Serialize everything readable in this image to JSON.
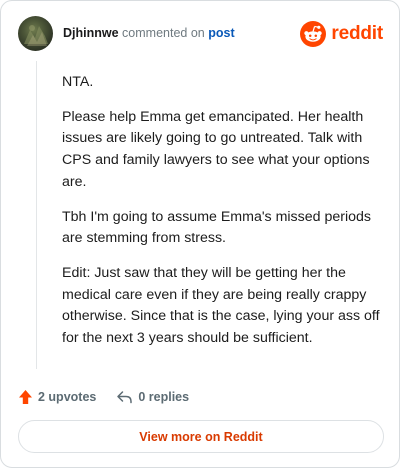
{
  "comment": {
    "author": "Djhinnwe",
    "verb": "commented on",
    "target_link": "post",
    "paragraphs": [
      "NTA.",
      "Please help Emma get emancipated. Her health issues are likely going to go untreated. Talk with CPS and family lawyers to see what your options are.",
      "Tbh I'm going to assume Emma's missed periods are stemming from stress.",
      "Edit: Just saw that they will be getting her the medical care even if they are being really crappy otherwise. Since that is the case, lying your ass off for the next 3 years should be sufficient."
    ]
  },
  "brand": {
    "name": "reddit",
    "color": "#ff4500",
    "icon": "reddit-alien-icon"
  },
  "actions": {
    "upvotes_label": "2 upvotes",
    "replies_label": "0 replies",
    "upvote_icon": "upvote-arrow-icon",
    "reply_icon": "reply-arrow-icon",
    "upvote_color": "#ff4500"
  },
  "footer": {
    "view_more_label": "View more on Reddit",
    "color": "#d93a00"
  }
}
